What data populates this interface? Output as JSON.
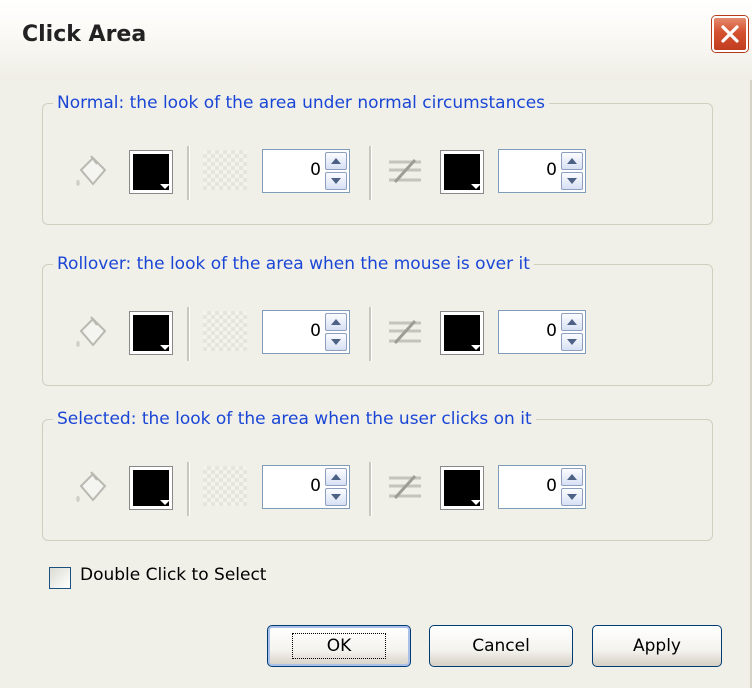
{
  "dialog": {
    "title": "Click Area",
    "close_icon": "close-icon",
    "groups": [
      {
        "label": "Normal: the look of the area under normal circumstances",
        "fill_color": "#000000",
        "fill_opacity": "0",
        "line_color": "#000000",
        "line_width": "0"
      },
      {
        "label": "Rollover: the look of the area when the mouse is over it",
        "fill_color": "#000000",
        "fill_opacity": "0",
        "line_color": "#000000",
        "line_width": "0"
      },
      {
        "label": "Selected: the look of the area when the user clicks on it",
        "fill_color": "#000000",
        "fill_opacity": "0",
        "line_color": "#000000",
        "line_width": "0"
      }
    ],
    "double_click_label": "Double Click to Select",
    "double_click_checked": false,
    "buttons": {
      "ok": "OK",
      "cancel": "Cancel",
      "apply": "Apply"
    },
    "colors": {
      "group_label": "#1a46d6",
      "close_button": "#d4512f"
    }
  }
}
